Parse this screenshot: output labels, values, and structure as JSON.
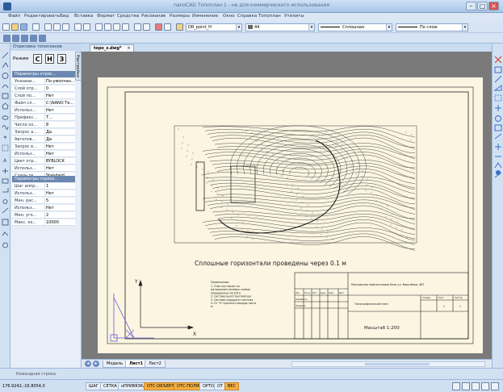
{
  "window": {
    "title": "nanoCAD Топоплан 1 - не для коммерческого использования"
  },
  "menu": [
    "Файл",
    "Редактировать",
    "Вид",
    "Вставка",
    "Формат",
    "Средства",
    "Рисование",
    "Размеры",
    "Изменение",
    "Окно",
    "Справка",
    "Топоплан",
    "Утилиты"
  ],
  "toolbar": {
    "layer_value": "DR_point_H",
    "color_value": "44",
    "linetype_value": "Сплошная",
    "lineweight_value": "По слою"
  },
  "panel": {
    "title": "Отрисовка топопланов",
    "side_tab": "Настройки",
    "mode_label": "Режим",
    "mode_buttons": [
      "С",
      "Н",
      "З"
    ],
    "section1": "Параметры отрис...",
    "rows1": [
      {
        "k": "Указани...",
        "v": "По-умолчан..."
      },
      {
        "k": "Слой отр...",
        "v": "0"
      },
      {
        "k": "Слой по...",
        "v": "Нет"
      },
      {
        "k": "Файл сл...",
        "v": "C:\\NANO Те..."
      },
      {
        "k": "Использ...",
        "v": "Нет"
      },
      {
        "k": "Префикс...",
        "v": "Т..."
      },
      {
        "k": "Число ох...",
        "v": "8"
      },
      {
        "k": "Запрос а...",
        "v": "Да"
      },
      {
        "k": "Автопов...",
        "v": "Да"
      },
      {
        "k": "Запрос в...",
        "v": "Нет"
      },
      {
        "k": "Использ...",
        "v": "Нет"
      },
      {
        "k": "Цвет отр...",
        "v": "BYBLOCK"
      },
      {
        "k": "Использ...",
        "v": "Нет"
      },
      {
        "k": "Стиль те...",
        "v": "Standard"
      }
    ],
    "section2": "Параметры горизо...",
    "rows2": [
      {
        "k": "Шаг аппр...",
        "v": "1"
      },
      {
        "k": "Использ...",
        "v": "Нет"
      },
      {
        "k": "Мин. рас...",
        "v": "5"
      },
      {
        "k": "Использ...",
        "v": "Нет"
      },
      {
        "k": "Мин. уго...",
        "v": "2"
      },
      {
        "k": "Макс. ко...",
        "v": "10000"
      }
    ]
  },
  "document": {
    "tab": "topo_z.dwg*"
  },
  "drawing": {
    "caption": "Сплошные горизонтали проведены через 0.1 м",
    "notes_title": "Примечания:",
    "notes": [
      "1. План составлен по",
      "материалам полевых съемок",
      "проведенных 09.2010.",
      "2. Система высот Балтийская",
      "3. Система координат местная",
      "4. От \"0\" принята площадь листа",
      "м."
    ],
    "stamp_title": "Московская нефтегазовая база ул. Вишнёвая, 46Т",
    "stamp_sheet": "Топографический план",
    "stamp_scale": "Масштаб 1:200",
    "stamp_cols": [
      "Стадия",
      "Лист",
      "Листов"
    ],
    "stamp_vals": [
      "",
      "1",
      "1"
    ],
    "stamp_rows": [
      "Разработал",
      "Проверил"
    ],
    "stamp_head": [
      "Изм.",
      "Кол.уч",
      "Лист",
      "№док.",
      "Подп.",
      "Дата"
    ],
    "ucs_x": "X",
    "ucs_y": "Y"
  },
  "layout_tabs": [
    "Модель",
    "Лист1",
    "Лист2"
  ],
  "active_layout": "Лист1",
  "command_line": "Командная строка",
  "status": {
    "coords": "176.9242,-16.8054,0",
    "buttons": [
      "ШАГ",
      "СЕТКА",
      "оПРИВЯЗКА",
      "ОТС-ОБЪЕКТ",
      "ОТС-ПОЛЯР",
      "ОРТО",
      "ОТ",
      "ВЕС"
    ],
    "active_buttons": [
      "ОТС-ОБЪЕКТ",
      "ОТС-ПОЛЯР",
      "ВЕС"
    ]
  },
  "colors": {
    "sheet": "#fbf5e2",
    "canvas": "#7a7a7a",
    "accent": "#f6b043"
  }
}
